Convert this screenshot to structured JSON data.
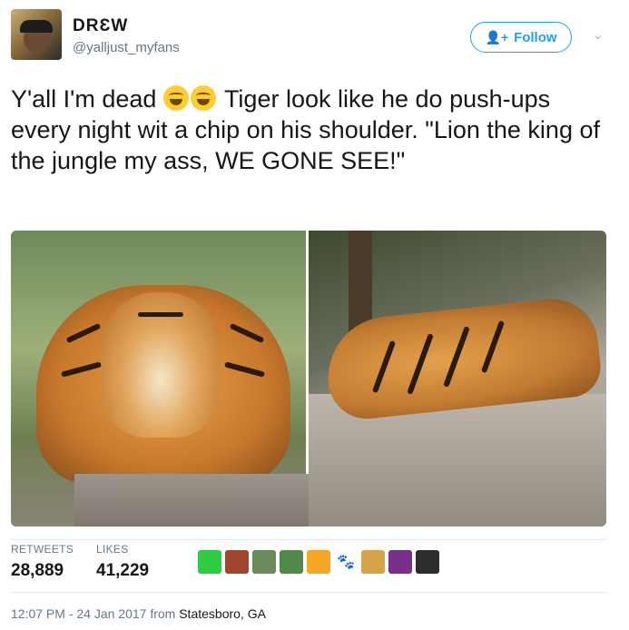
{
  "user": {
    "name": "DRƐW",
    "handle": "@yalljust_myfans"
  },
  "header": {
    "follow_label": "Follow",
    "follow_icon": "+",
    "caret": "⌄"
  },
  "tweet": {
    "text_part1": "Y'all I'm dead",
    "text_part2": " Tiger look like he do push-ups every night wit a chip on his shoulder. \"Lion the king of the jungle my ass, WE GONE SEE!\""
  },
  "stats": {
    "retweets_label": "RETWEETS",
    "retweets_value": "28,889",
    "likes_label": "LIKES",
    "likes_value": "41,229"
  },
  "likers": [
    {
      "color": "#2ecc40"
    },
    {
      "color": "#a0442e"
    },
    {
      "color": "#6a8a5a"
    },
    {
      "color": "#4f8a4a"
    },
    {
      "color": "#f5a623"
    },
    {
      "color": "#ffffff"
    },
    {
      "color": "#d6a34a"
    },
    {
      "color": "#7a2f8a"
    },
    {
      "color": "#2d2d2d"
    }
  ],
  "footer": {
    "timestamp": "12:07 PM - 24 Jan 2017",
    "from_label": " from ",
    "location": "Statesboro, GA"
  },
  "icons": {
    "emoji": "face-with-tears-of-joy-icon",
    "paw": "paw-icon"
  }
}
